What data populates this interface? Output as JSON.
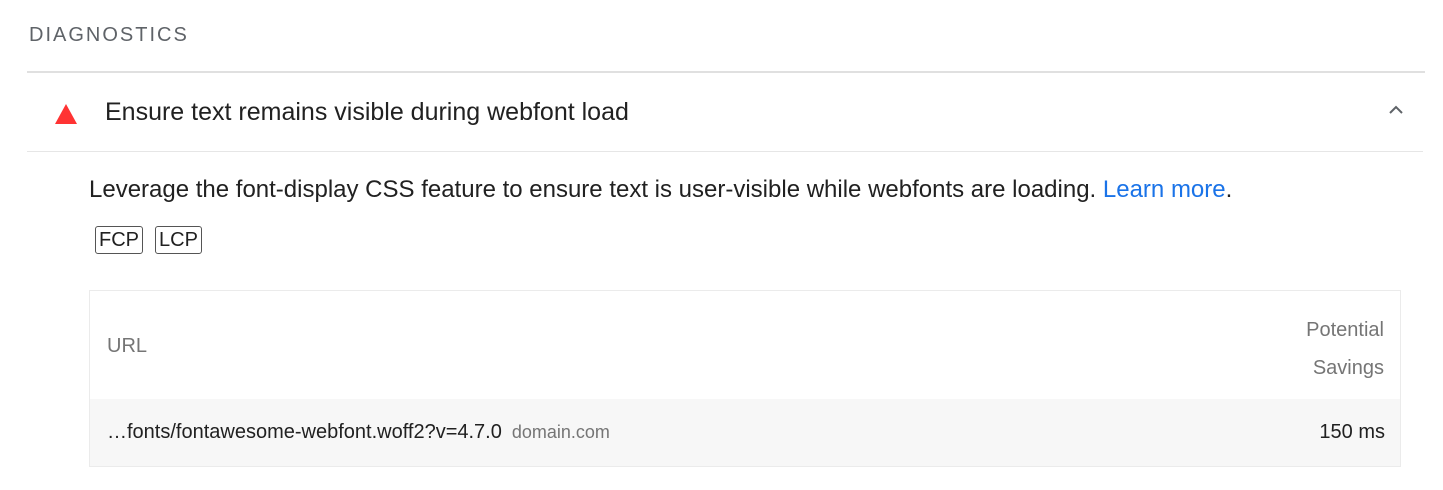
{
  "section": {
    "title": "DIAGNOSTICS"
  },
  "audit": {
    "title": "Ensure text remains visible during webfont load",
    "status_icon": "warning-triangle-icon",
    "status_color": "#ff3333",
    "expanded": true,
    "description": "Leverage the font-display CSS feature to ensure text is user-visible while webfonts are loading. ",
    "learn_more_label": "Learn more",
    "description_suffix": ".",
    "link_color": "#1a73e8",
    "badges": [
      "FCP",
      "LCP"
    ]
  },
  "table": {
    "headers": {
      "url": "URL",
      "savings_line1": "Potential",
      "savings_line2": "Savings"
    },
    "rows": [
      {
        "url": "…fonts/fontawesome-webfont.woff2?v=4.7.0",
        "domain": "domain.com",
        "savings": "150 ms"
      }
    ]
  }
}
